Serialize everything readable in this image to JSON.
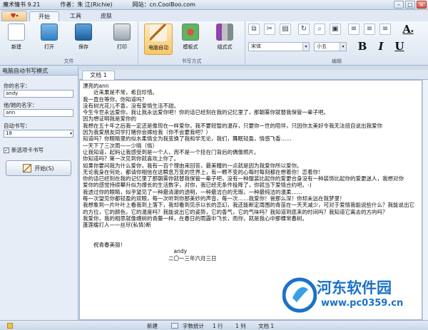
{
  "titlebar": {
    "app_title": "魔术情书 9.21",
    "author": "作者：朱 江(Richie)",
    "website": "网站：cn.CoolBoo.com"
  },
  "menu_tabs": [
    "开始",
    "工具",
    "皮肤"
  ],
  "ribbon": {
    "file_group": {
      "label": "文件",
      "buttons": [
        "新建",
        "打开",
        "保存",
        "打印"
      ]
    },
    "mode_group": {
      "label": "书写方式",
      "buttons": [
        "电脑自动",
        "模板式",
        "组式式"
      ]
    },
    "edit_group": {
      "label": "编辑",
      "font_value": "宋体",
      "size_value": "小五",
      "format_labels": [
        "B",
        "I",
        "U"
      ]
    }
  },
  "left_panel": {
    "header": "电脑自动书写模式",
    "your_name_label": "你的名字：",
    "your_name_value": "andy",
    "other_name_label": "他/她的名字：",
    "other_name_value": "ann",
    "auto_write_label": "自动书写：",
    "auto_write_value": "18",
    "new_option_label": "新选项卡书写",
    "start_label": "开始(S)"
  },
  "doc_tab": "文档 1",
  "document_lines": [
    "漂亮的ann",
    "　　近来果是不常，希自珍惜。",
    "我一直在等你，你知道吗？",
    "没有树光花儿不香，没有爱情生活不甜。",
    "今生今世永远爱你，我让我永远爱你吧！你的话已经刻在我的记忆里了，那朝雾你就替我保管一辈子吧。",
    "因为想证明我是爱你的",
    "我想在五十年之后我一定还是像现在一样爱你，我不要短暂的温存，只要你一世的陪伴，只因你太美好令我无法扭自说出我爱你",
    "因为我爱朋友同学打赌你会嫁给我（你不会要我吧？）",
    "知道吗？你眼睛里的似水柔情全为我变换了我和学无论，我们，舞眠轻盈，情感飞香……",
    "一天下了三次雨——少晴（情）",
    "让我知道，起码让我感受到是一个人，而不是一个挂在门背后的偶像照片。",
    "你知道吗？第一次见到你就喜欢上你了。",
    "如果你要问我为什么爱你，我有一百个理由来回答，最美瞳的一点就是因为我爱你所以爱你。",
    "无论我身在何处，都请你相信在这瞬息万变的世界上，有一颗不变的心每时每刻都在想着你！恋着你！",
    "你的话已经刻在我的记忆里了那朝雾你就替我保管一辈子吧，没有一种服装比起你的爱更合身没有一种装饰比起你的爱更迷人，我想对你",
    "爱你的感觉持续攀升似为爆长的生活数字，对你，我已经无条件投降了，你就当下爱情合约吧。-)",
    "我透过你的眼睛，似乎望见了一种最清澈的透明，一种最洁白的无瑕，一种最纯洁的温柔……",
    "每一次望见你都轻盈的双眼，每一次听到你那美妙的声音，每一次……我爱你！爸那么深！你却未远在我梦里！",
    "我想象到一片叶叶上看我到上落下，我却看到见示以长的恋幻，我还能断定周围的青苗在一天天减少，可对于爱情我能说些什么？我能说出它",
    "的方位，它的颜色，它的温度吗？我能说出它的姿势，它的香气，它的气味吗？我知道到底来的时间吗？我知道它离去的方向吗？",
    "我爱你，我的相思就像缠树的青藤一样，在春日的雨露中飞长，而你，就是我心中那棵常春树。",
    "蓬莲缓打人——丝尽(私情)断",
    "",
    "",
    "　　祝青春美丽！",
    "　　　　　　　　　　　　　　　　　andy",
    "　　　　　　　　　　　　　　　　二〇一三年六月三日"
  ],
  "statusbar": {
    "mode": "新建",
    "stats": "字数统计",
    "row": "1 行",
    "col": "1 列",
    "doc": "文档 1"
  },
  "watermark": {
    "text": "河东软件园",
    "url": "www.pc0359.cn"
  },
  "colors": {
    "accent": "#1b72c8",
    "ribbon_selected": "#f7c868",
    "panel_bg": "#e6edf6"
  }
}
